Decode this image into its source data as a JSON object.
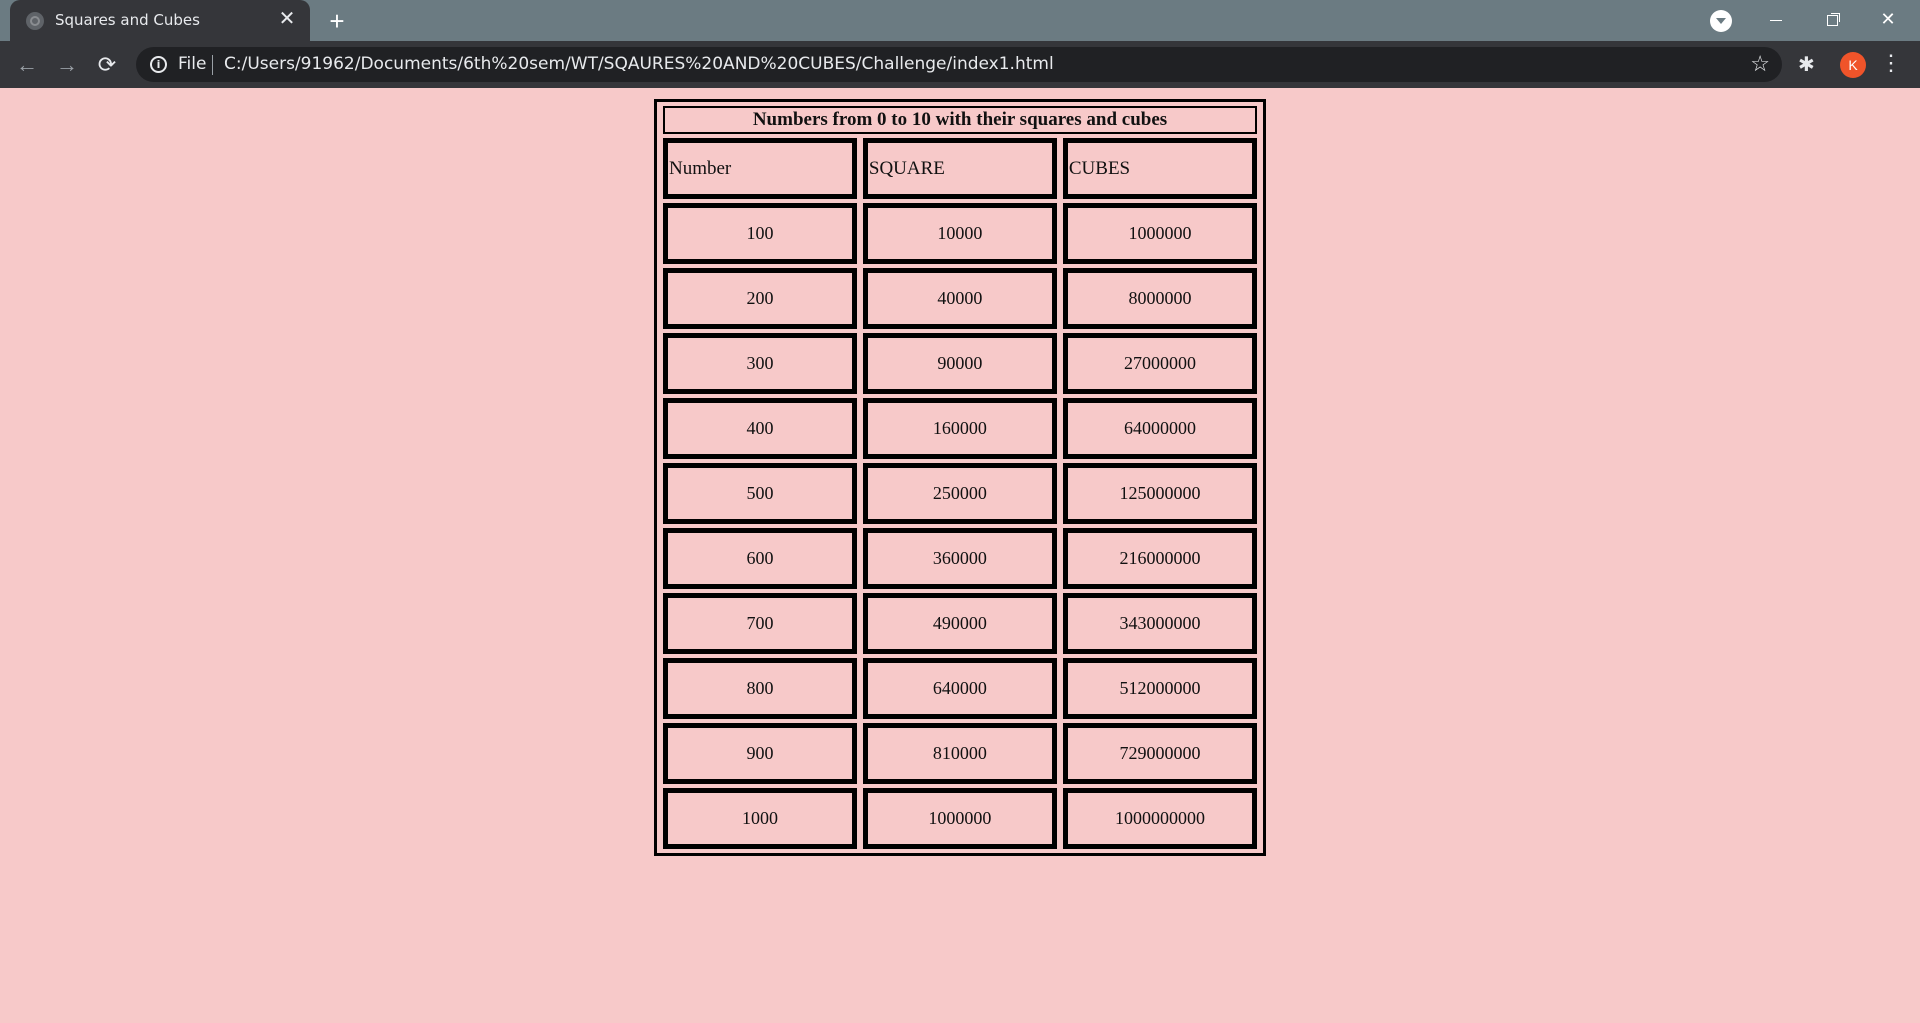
{
  "browser": {
    "tab_title": "Squares and Cubes",
    "close_glyph": "✕",
    "newtab_glyph": "+",
    "file_label": "File",
    "url": "C:/Users/91962/Documents/6th%20sem/WT/SQAURES%20AND%20CUBES/Challenge/index1.html",
    "profile_initial": "K",
    "profile_color": "#f0542a"
  },
  "table": {
    "title": "Numbers from 0 to 10 with their squares and cubes",
    "headers": [
      "Number",
      "SQUARE",
      "CUBES"
    ],
    "rows": [
      [
        "100",
        "10000",
        "1000000"
      ],
      [
        "200",
        "40000",
        "8000000"
      ],
      [
        "300",
        "90000",
        "27000000"
      ],
      [
        "400",
        "160000",
        "64000000"
      ],
      [
        "500",
        "250000",
        "125000000"
      ],
      [
        "600",
        "360000",
        "216000000"
      ],
      [
        "700",
        "490000",
        "343000000"
      ],
      [
        "800",
        "640000",
        "512000000"
      ],
      [
        "900",
        "810000",
        "729000000"
      ],
      [
        "1000",
        "1000000",
        "1000000000"
      ]
    ]
  },
  "colors": {
    "page_background": "#f7c9c9",
    "border": "#000000"
  }
}
